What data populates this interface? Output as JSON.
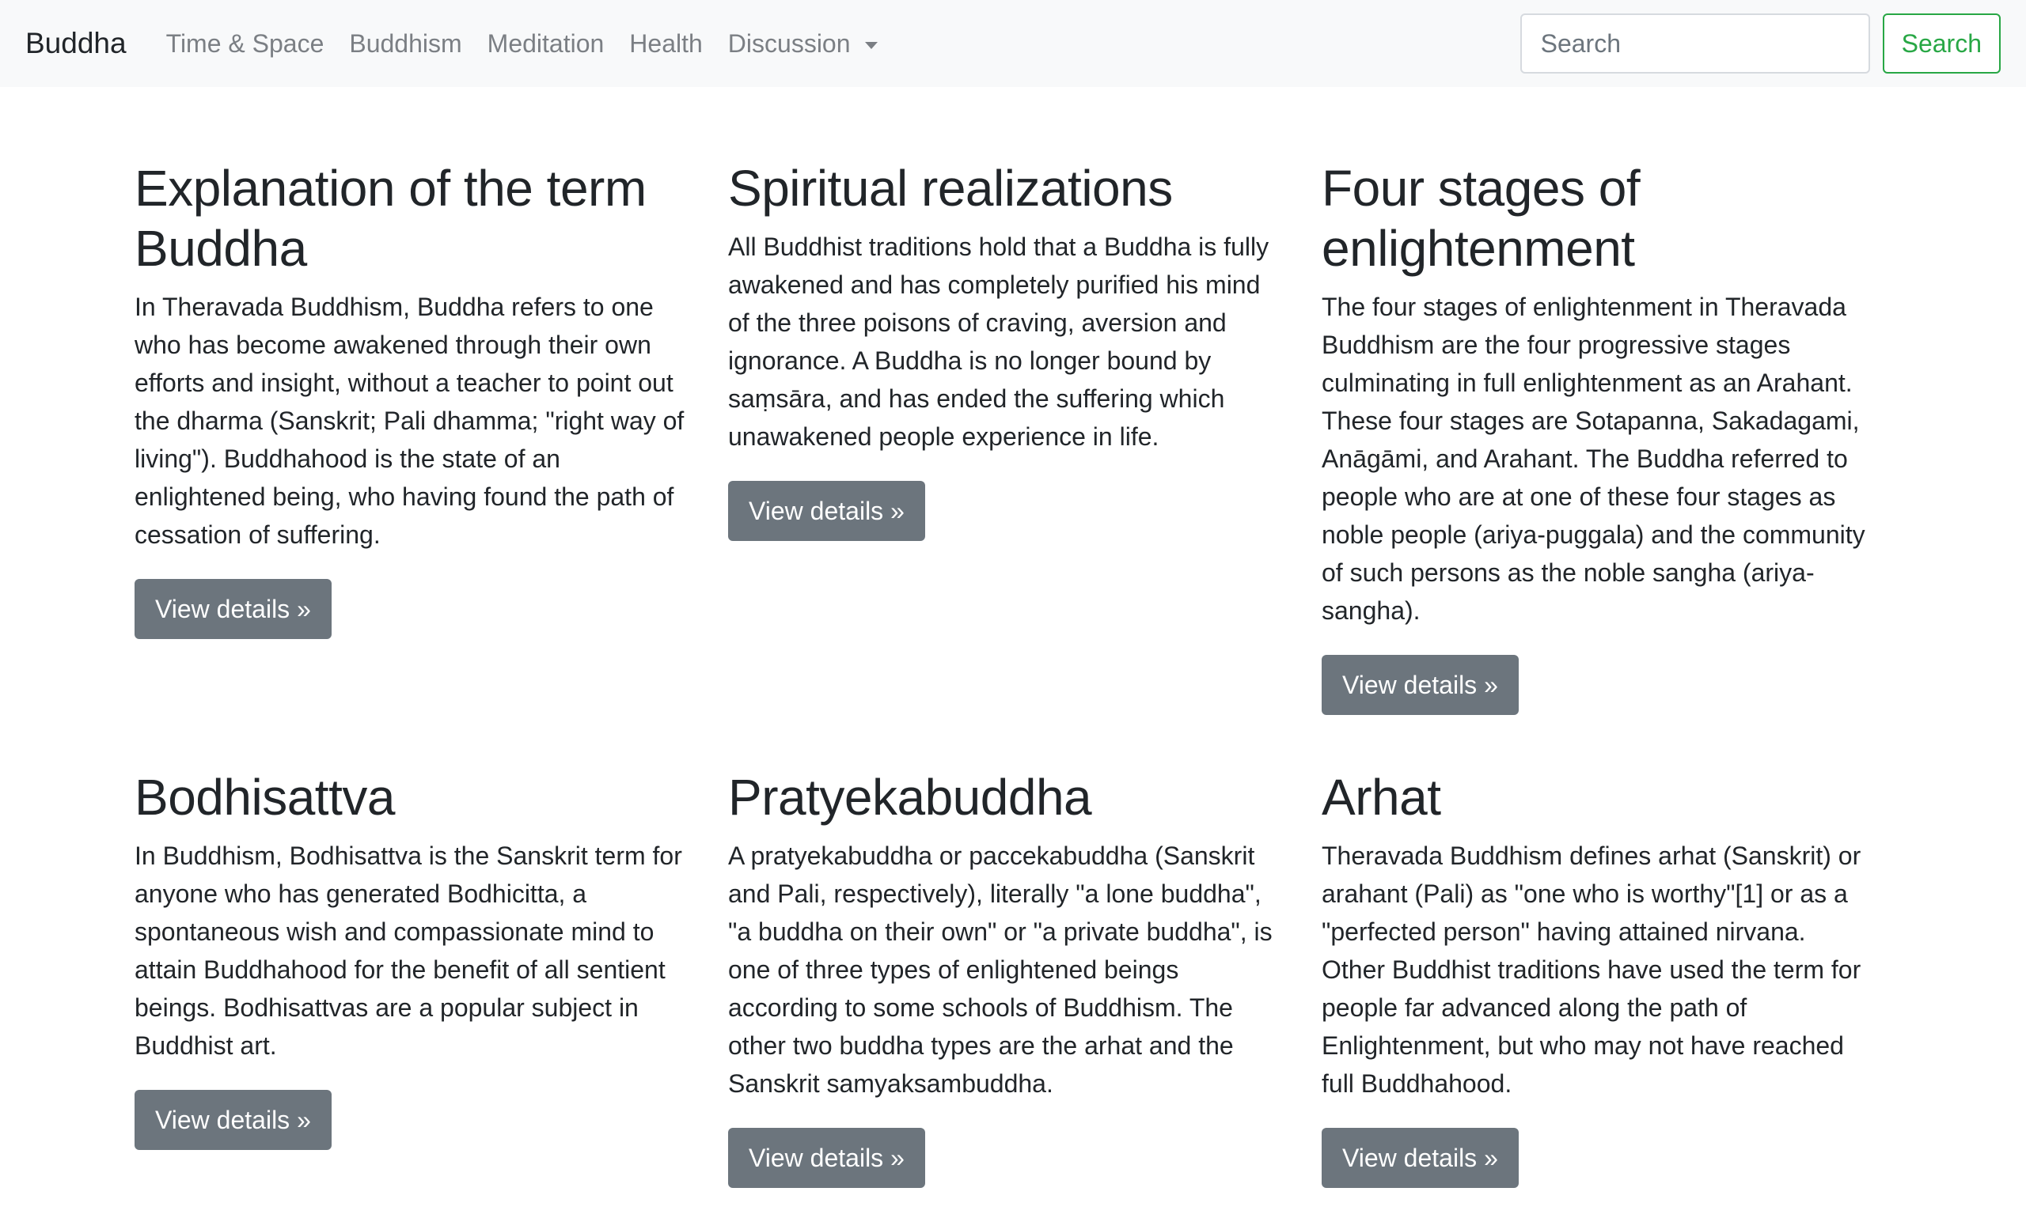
{
  "navbar": {
    "brand": "Buddha",
    "links": [
      {
        "label": "Time & Space"
      },
      {
        "label": "Buddhism"
      },
      {
        "label": "Meditation"
      },
      {
        "label": "Health"
      },
      {
        "label": "Discussion"
      }
    ],
    "search": {
      "placeholder": "Search",
      "button_label": "Search"
    }
  },
  "colors": {
    "navbar_bg": "#f8f9fa",
    "link": "#7b7f84",
    "success": "#28a745",
    "secondary_button": "#6c757d"
  },
  "cards": [
    {
      "title": "Explanation of the term Buddha",
      "text": "In Theravada Buddhism, Buddha refers to one who has become awakened through their own efforts and insight, without a teacher to point out the dharma (Sanskrit; Pali dhamma; \"right way of living\"). Buddhahood is the state of an enlightened being, who having found the path of cessation of suffering.",
      "button": "View details »"
    },
    {
      "title": "Spiritual realizations",
      "text": "All Buddhist traditions hold that a Buddha is fully awakened and has completely purified his mind of the three poisons of craving, aversion and ignorance. A Buddha is no longer bound by saṃsāra, and has ended the suffering which unawakened people experience in life.",
      "button": "View details »"
    },
    {
      "title": "Four stages of enlightenment",
      "text": "The four stages of enlightenment in Theravada Buddhism are the four progressive stages culminating in full enlightenment as an Arahant. These four stages are Sotapanna, Sakadagami, Anāgāmi, and Arahant. The Buddha referred to people who are at one of these four stages as noble people (ariya-puggala) and the community of such persons as the noble sangha (ariya-sangha).",
      "button": "View details »"
    },
    {
      "title": "Bodhisattva",
      "text": "In Buddhism, Bodhisattva is the Sanskrit term for anyone who has generated Bodhicitta, a spontaneous wish and compassionate mind to attain Buddhahood for the benefit of all sentient beings. Bodhisattvas are a popular subject in Buddhist art.",
      "button": "View details »"
    },
    {
      "title": "Pratyekabuddha",
      "text": "A pratyekabuddha or paccekabuddha (Sanskrit and Pali, respectively), literally \"a lone buddha\", \"a buddha on their own\" or \"a private buddha\", is one of three types of enlightened beings according to some schools of Buddhism. The other two buddha types are the arhat and the Sanskrit samyaksambuddha.",
      "button": "View details »"
    },
    {
      "title": "Arhat",
      "text": "Theravada Buddhism defines arhat (Sanskrit) or arahant (Pali) as \"one who is worthy\"[1] or as a \"perfected person\" having attained nirvana. Other Buddhist traditions have used the term for people far advanced along the path of Enlightenment, but who may not have reached full Buddhahood.",
      "button": "View details »"
    }
  ]
}
